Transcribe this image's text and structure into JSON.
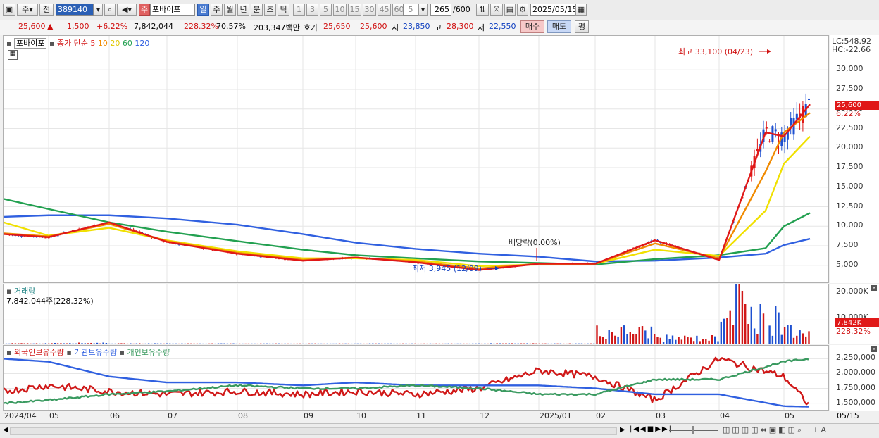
{
  "toolbar": {
    "market": "주",
    "prev": "전",
    "code": "389140",
    "name_badge": "주",
    "stock_name": "포바이포",
    "periods": [
      "일",
      "주",
      "월",
      "년",
      "분",
      "초",
      "틱"
    ],
    "selected_period": "일",
    "minutes": [
      "1",
      "3",
      "5",
      "10",
      "15",
      "30",
      "45",
      "60"
    ],
    "minute_value": "5",
    "count": "265",
    "count_max": "/600",
    "date": "2025/05/15"
  },
  "quote": {
    "price": "25,600",
    "change": "1,500",
    "change_pct": "+6.22%",
    "volume": "7,842,044",
    "volume_ratio": "228.32%",
    "turnover": "70.57%",
    "amount": "203,347백만",
    "ask_label": "호가",
    "ask": "25,650",
    "bid": "25,600",
    "open_label": "시",
    "open": "23,850",
    "high_label": "고",
    "high": "28,300",
    "low_label": "저",
    "low": "22,550",
    "buy_label": "매수",
    "sell_label": "매도",
    "eval_label": "평"
  },
  "price_pane": {
    "legend_name": "포바이포",
    "legend_type": "종가 단순",
    "ma_periods": [
      "5",
      "10",
      "20",
      "60",
      "120"
    ],
    "ma_colors": [
      "#e01818",
      "#f08a00",
      "#f0e000",
      "#22a050",
      "#3060e0"
    ],
    "lc": "LC:548.92",
    "hc": "HC:-22.66",
    "current_tag": "25,600",
    "current_pct": "6.22%",
    "y_ticks": [
      "30,000",
      "27,500",
      "25,000",
      "22,500",
      "20,000",
      "17,500",
      "15,000",
      "12,500",
      "10,000",
      "7,500",
      "5,000"
    ],
    "annotations": {
      "high": "최고 33,100 (04/23)",
      "low": "최저 3,945 (12/09)",
      "dividend": "배당락(0.00%)"
    }
  },
  "volume_pane": {
    "title": "거래량",
    "value": "7,842,044주(228.32%)",
    "y_ticks": [
      "20,000K",
      "10,000K"
    ],
    "current_tag": "7,842K",
    "current_pct": "228.32%"
  },
  "holding_pane": {
    "series": [
      "외국인보유수량",
      "기관보유수량",
      "개인보유수량"
    ],
    "colors": [
      "#d01818",
      "#3060e0",
      "#3a9a60"
    ],
    "y_ticks": [
      "2,250,000",
      "2,000,000",
      "1,750,000",
      "1,500,000"
    ]
  },
  "x_axis": [
    "2024/04",
    "05",
    "06",
    "07",
    "08",
    "09",
    "10",
    "11",
    "12",
    "2025/01",
    "02",
    "03",
    "04",
    "05"
  ],
  "x_axis_last": "05/15",
  "chart_data": [
    {
      "type": "line",
      "title": "포바이포 종가 단순",
      "x": [
        "2024/04",
        "05",
        "06",
        "07",
        "08",
        "09",
        "10",
        "11",
        "12",
        "2025/01",
        "02",
        "03",
        "04",
        "04/23",
        "05",
        "05/15"
      ],
      "series": [
        {
          "name": "5",
          "values": [
            9000,
            8600,
            10500,
            8000,
            6500,
            5600,
            6000,
            5400,
            4400,
            5200,
            5200,
            8200,
            5700,
            22000,
            21500,
            25600
          ]
        },
        {
          "name": "10",
          "values": [
            9100,
            8700,
            10300,
            8100,
            6600,
            5700,
            6000,
            5500,
            4600,
            5200,
            5200,
            7800,
            5900,
            17000,
            22000,
            24500
          ]
        },
        {
          "name": "20",
          "values": [
            10500,
            8800,
            9800,
            8200,
            6800,
            5900,
            5900,
            5700,
            4900,
            5100,
            5200,
            7000,
            6200,
            12000,
            18000,
            21500
          ]
        },
        {
          "name": "60",
          "values": [
            13500,
            12200,
            10500,
            9300,
            8100,
            7000,
            6300,
            5900,
            5500,
            5300,
            5100,
            5800,
            6300,
            7200,
            10000,
            11700
          ]
        },
        {
          "name": "120",
          "values": [
            11200,
            11400,
            11400,
            11000,
            10200,
            9000,
            7900,
            7100,
            6500,
            6100,
            5500,
            5600,
            6000,
            6500,
            7600,
            8400
          ]
        }
      ],
      "ylim": [
        3000,
        33000
      ]
    },
    {
      "type": "bar",
      "title": "거래량",
      "categories": [
        "2024/04",
        "05",
        "06",
        "07",
        "08",
        "09",
        "10",
        "11",
        "12",
        "2025/01",
        "02",
        "03",
        "04",
        "05"
      ],
      "values": [
        150,
        300,
        120,
        90,
        80,
        70,
        80,
        70,
        120,
        90,
        5500,
        2500,
        18500,
        7842
      ],
      "ylabel": "K",
      "ylim": [
        0,
        22000
      ]
    },
    {
      "type": "line",
      "title": "보유수량",
      "x": [
        "2024/04",
        "05",
        "06",
        "07",
        "08",
        "09",
        "10",
        "11",
        "12",
        "2025/01",
        "02",
        "03",
        "04",
        "05",
        "05/15"
      ],
      "series": [
        {
          "name": "외국인보유수량",
          "values": [
            1700000,
            1800000,
            1700000,
            1650000,
            1700000,
            1650000,
            1700000,
            1650000,
            1750000,
            2050000,
            1950000,
            1550000,
            2250000,
            1950000,
            1450000
          ]
        },
        {
          "name": "기관보유수량",
          "values": [
            2250000,
            2200000,
            1950000,
            1850000,
            1850000,
            1800000,
            1850000,
            1800000,
            1800000,
            1800000,
            1750000,
            1650000,
            1650000,
            1450000,
            1440000
          ]
        },
        {
          "name": "개인보유수량",
          "values": [
            1500000,
            1550000,
            1650000,
            1700000,
            1800000,
            1750000,
            1750000,
            1800000,
            1750000,
            1650000,
            1650000,
            1900000,
            1900000,
            2200000,
            2250000
          ]
        }
      ],
      "ylim": [
        1400000,
        2350000
      ]
    }
  ]
}
